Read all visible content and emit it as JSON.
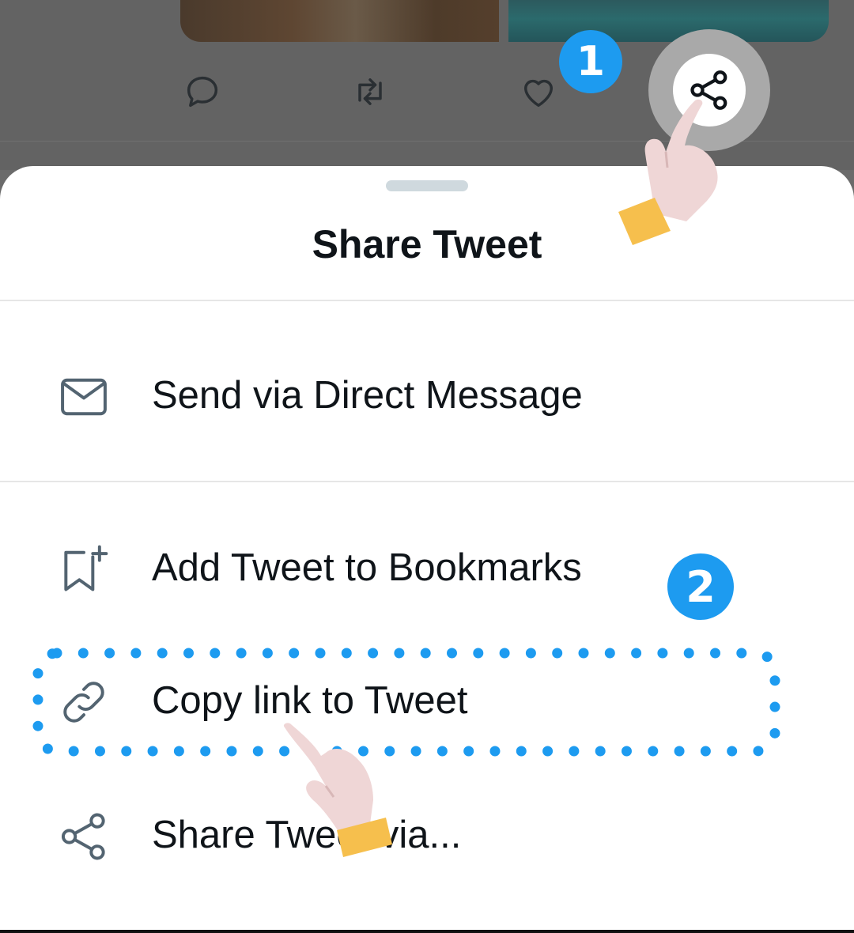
{
  "tweet_actions": {
    "reply_icon": "reply-icon",
    "retweet_icon": "retweet-icon",
    "like_icon": "heart-icon",
    "share_icon": "share-icon"
  },
  "steps": {
    "step_1": "1",
    "step_2": "2"
  },
  "share_sheet": {
    "title": "Share Tweet",
    "items": [
      {
        "label": "Send via Direct Message",
        "icon": "envelope-icon"
      },
      {
        "label": "Add Tweet to Bookmarks",
        "icon": "bookmark-add-icon"
      },
      {
        "label": "Copy link to Tweet",
        "icon": "link-icon"
      },
      {
        "label": "Share Tweet via...",
        "icon": "share-icon"
      }
    ]
  },
  "colors": {
    "accent": "#1d9bf0",
    "text": "#0f1419",
    "icon_gray": "#536471",
    "overlay": "#636363"
  }
}
